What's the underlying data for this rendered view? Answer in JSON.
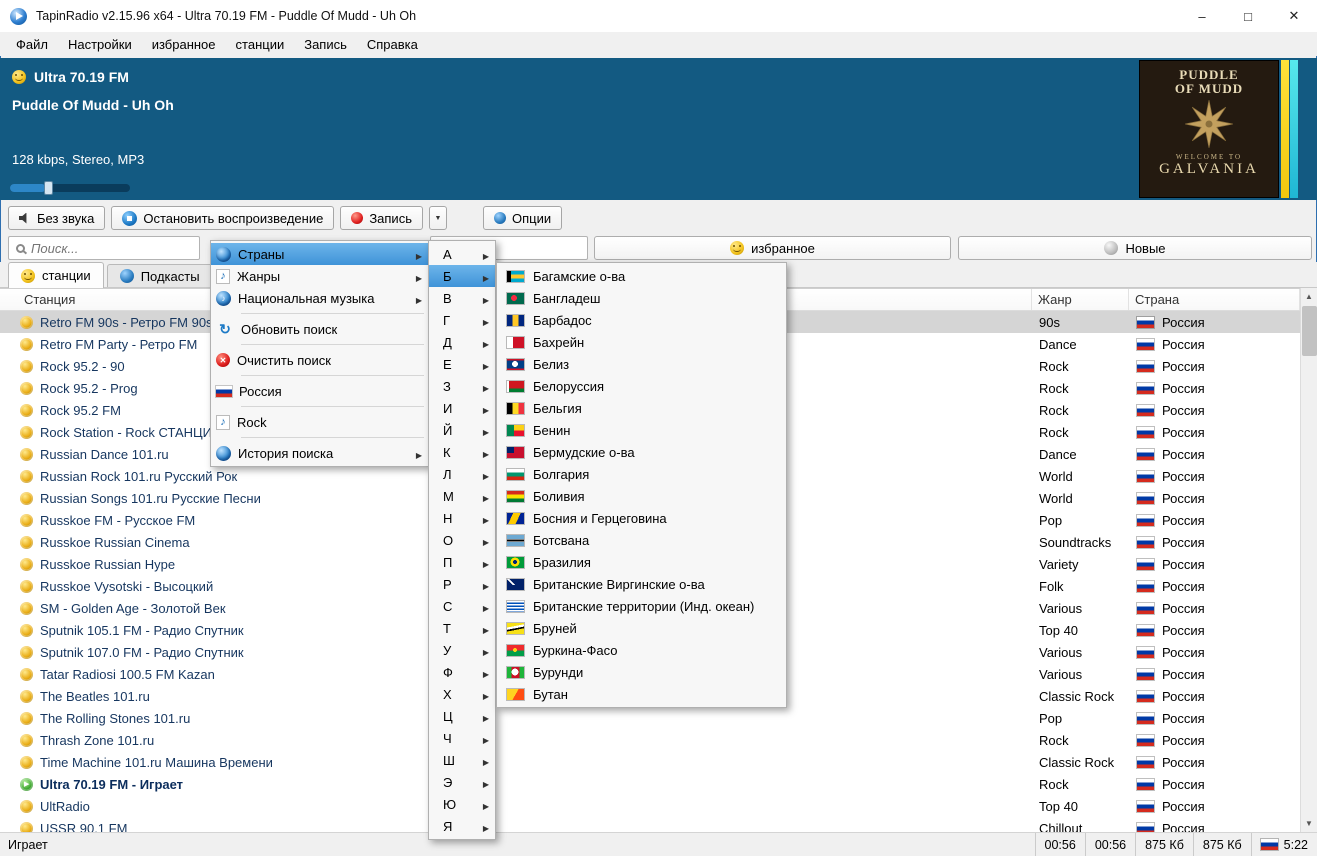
{
  "window": {
    "title": "TapinRadio v2.15.96 x64  -  Ultra 70.19 FM - Puddle Of Mudd - Uh Oh",
    "controls": {
      "minimize": "–",
      "maximize": "□",
      "close": "✕"
    }
  },
  "menubar": [
    {
      "label": "Файл"
    },
    {
      "label": "Настройки"
    },
    {
      "label": "избранное"
    },
    {
      "label": "станции"
    },
    {
      "label": "Запись"
    },
    {
      "label": "Справка"
    }
  ],
  "player": {
    "station": "Ultra 70.19 FM",
    "track": "Puddle Of Mudd - Uh Oh",
    "stream_info": "128 kbps, Stereo, MP3",
    "volume_percent": 30,
    "album": {
      "artist_line1": "PUDDLE",
      "artist_line2": "OF MUDD",
      "welcome": "WELCOME TO",
      "title": "GALVANIA"
    },
    "accent_colors": {
      "panel": "#135a82",
      "meter_yellow": "#f2c70e",
      "meter_cyan": "#1fb6d4"
    }
  },
  "toolbar": {
    "mute_label": "Без звука",
    "stop_label": "Остановить воспроизведение",
    "record_label": "Запись",
    "record_dropdown": "▼",
    "options_label": "Опции"
  },
  "filters": {
    "search_placeholder": "Поиск...",
    "favorites_label": "избранное",
    "new_label": "Новые"
  },
  "tabs": [
    {
      "label": "станции",
      "cls": "active",
      "icon": "ic-smiley"
    },
    {
      "label": "Подкасты",
      "cls": "",
      "icon": "ic-podcast"
    }
  ],
  "table": {
    "header": {
      "station": "Станция",
      "genre": "Жанр",
      "country": "Страна"
    },
    "rows": [
      {
        "name": "Retro FM 90s - Ретро FM 90s",
        "genre": "90s",
        "country": "Россия",
        "cls": "selected"
      },
      {
        "name": "Retro FM Party - Ретро FM",
        "genre": "Dance",
        "country": "Россия",
        "cls": ""
      },
      {
        "name": "Rock 95.2 - 90",
        "genre": "Rock",
        "country": "Россия",
        "cls": ""
      },
      {
        "name": "Rock 95.2 - Prog",
        "genre": "Rock",
        "country": "Россия",
        "cls": ""
      },
      {
        "name": "Rock 95.2 FM",
        "genre": "Rock",
        "country": "Россия",
        "cls": ""
      },
      {
        "name": "Rock Station - Rock СТАНЦИЯ",
        "genre": "Rock",
        "country": "Россия",
        "cls": ""
      },
      {
        "name": "Russian Dance 101.ru",
        "genre": "Dance",
        "country": "Россия",
        "cls": ""
      },
      {
        "name": "Russian Rock 101.ru Русский Рок",
        "genre": "World",
        "country": "Россия",
        "cls": ""
      },
      {
        "name": "Russian Songs 101.ru Русские Песни",
        "genre": "World",
        "country": "Россия",
        "cls": ""
      },
      {
        "name": "Russkoe FM - Русское FM",
        "genre": "Pop",
        "country": "Россия",
        "cls": ""
      },
      {
        "name": "Russkoe Russian Cinema",
        "genre": "Soundtracks",
        "country": "Россия",
        "cls": ""
      },
      {
        "name": "Russkoe Russian Hype",
        "genre": "Variety",
        "country": "Россия",
        "cls": ""
      },
      {
        "name": "Russkoe Vysotski - Высоцкий",
        "genre": "Folk",
        "country": "Россия",
        "cls": ""
      },
      {
        "name": "SM - Golden Age - Золотой Век",
        "genre": "Various",
        "country": "Россия",
        "cls": ""
      },
      {
        "name": "Sputnik 105.1 FM - Радио Спутник",
        "genre": "Top 40",
        "country": "Россия",
        "cls": ""
      },
      {
        "name": "Sputnik 107.0 FM - Радио Спутник",
        "genre": "Various",
        "country": "Россия",
        "cls": ""
      },
      {
        "name": "Tatar Radiosi 100.5 FM Kazan",
        "genre": "Various",
        "country": "Россия",
        "cls": ""
      },
      {
        "name": "The Beatles 101.ru",
        "genre": "Classic Rock",
        "country": "Россия",
        "cls": ""
      },
      {
        "name": "The Rolling Stones 101.ru",
        "genre": "Pop",
        "country": "Россия",
        "cls": ""
      },
      {
        "name": "Thrash Zone 101.ru",
        "genre": "Rock",
        "country": "Россия",
        "cls": ""
      },
      {
        "name": "Time Machine 101.ru Машина Времени",
        "genre": "Classic Rock",
        "country": "Россия",
        "cls": ""
      },
      {
        "name": "Ultra 70.19 FM - Играет",
        "genre": "Rock",
        "country": "Россия",
        "cls": "playing"
      },
      {
        "name": "UltRadio",
        "genre": "Top 40",
        "country": "Россия",
        "cls": ""
      },
      {
        "name": "USSR 90.1 FM",
        "genre": "Chillout",
        "country": "Россия",
        "cls": ""
      }
    ]
  },
  "context_menu": {
    "items": [
      {
        "label": "Страны",
        "icon": "ic-globe",
        "arrow": "has-sub",
        "cls": "hl"
      },
      {
        "label": "Жанры",
        "icon": "ic-note",
        "arrow": "has-sub",
        "cls": ""
      },
      {
        "label": "Национальная музыка",
        "icon": "ic-globe2",
        "arrow": "has-sub",
        "cls": ""
      },
      {
        "label": "",
        "icon": "",
        "arrow": "",
        "cls": "sep"
      },
      {
        "label": "Обновить поиск",
        "icon": "ic-refresh",
        "arrow": "",
        "cls": ""
      },
      {
        "label": "",
        "icon": "",
        "arrow": "",
        "cls": "sep"
      },
      {
        "label": "Очистить поиск",
        "icon": "ic-clear",
        "arrow": "",
        "cls": ""
      },
      {
        "label": "",
        "icon": "",
        "arrow": "",
        "cls": "sep"
      },
      {
        "label": "Россия",
        "icon": "ic-flag-ru",
        "arrow": "",
        "cls": ""
      },
      {
        "label": "",
        "icon": "",
        "arrow": "",
        "cls": "sep"
      },
      {
        "label": "Rock",
        "icon": "ic-note",
        "arrow": "",
        "cls": ""
      },
      {
        "label": "",
        "icon": "",
        "arrow": "",
        "cls": "sep"
      },
      {
        "label": "История поиска",
        "icon": "ic-globe",
        "arrow": "has-sub",
        "cls": ""
      }
    ]
  },
  "alphabet_menu": {
    "letters": [
      {
        "ch": "А",
        "cls": ""
      },
      {
        "ch": "Б",
        "cls": "hl"
      },
      {
        "ch": "В",
        "cls": ""
      },
      {
        "ch": "Г",
        "cls": ""
      },
      {
        "ch": "Д",
        "cls": ""
      },
      {
        "ch": "Е",
        "cls": ""
      },
      {
        "ch": "З",
        "cls": ""
      },
      {
        "ch": "И",
        "cls": ""
      },
      {
        "ch": "Й",
        "cls": ""
      },
      {
        "ch": "К",
        "cls": ""
      },
      {
        "ch": "Л",
        "cls": ""
      },
      {
        "ch": "М",
        "cls": ""
      },
      {
        "ch": "Н",
        "cls": ""
      },
      {
        "ch": "О",
        "cls": ""
      },
      {
        "ch": "П",
        "cls": ""
      },
      {
        "ch": "Р",
        "cls": ""
      },
      {
        "ch": "С",
        "cls": ""
      },
      {
        "ch": "Т",
        "cls": ""
      },
      {
        "ch": "У",
        "cls": ""
      },
      {
        "ch": "Ф",
        "cls": ""
      },
      {
        "ch": "Х",
        "cls": ""
      },
      {
        "ch": "Ц",
        "cls": ""
      },
      {
        "ch": "Ч",
        "cls": ""
      },
      {
        "ch": "Ш",
        "cls": ""
      },
      {
        "ch": "Э",
        "cls": ""
      },
      {
        "ch": "Ю",
        "cls": ""
      },
      {
        "ch": "Я",
        "cls": ""
      }
    ]
  },
  "country_menu": {
    "items": [
      {
        "name": "Багамские о-ва",
        "flag": "linear-gradient(90deg,#000 0,#000 4px,rgba(0,0,0,0) 4px),linear-gradient(180deg,#00a9ce 0,#00a9ce 33%,#ffc72c 33%,#ffc72c 67%,#00a9ce 67%)"
      },
      {
        "name": "Бангладеш",
        "flag": "radial-gradient(circle 3px at 7px 5px,#f42a41 97%,rgba(0,0,0,0) 100%),linear-gradient(#006a4e,#006a4e)"
      },
      {
        "name": "Барбадос",
        "flag": "linear-gradient(90deg,#00267f 0,#00267f 33%,#ffc726 33%,#ffc726 67%,#00267f 67%)"
      },
      {
        "name": "Бахрейн",
        "flag": "linear-gradient(90deg,#fff 0,#fff 35%,#ce1126 35%)"
      },
      {
        "name": "Белиз",
        "flag": "radial-gradient(circle 3px at 8px 5px,#fff 97%,rgba(0,0,0,0) 100%),linear-gradient(180deg,#ce1126 0,#ce1126 15%,#003f87 15%,#003f87 85%,#ce1126 85%)"
      },
      {
        "name": "Белоруссия",
        "flag": "linear-gradient(90deg,#fff 0,#fff 2px,rgba(0,0,0,0) 2px),linear-gradient(180deg,#ce1720 0,#ce1720 67%,#007c30 67%)"
      },
      {
        "name": "Бельгия",
        "flag": "linear-gradient(90deg,#000 0,#000 33%,#fdda24 33%,#fdda24 67%,#ef3340 67%)"
      },
      {
        "name": "Бенин",
        "flag": "linear-gradient(90deg,#008751 0,#008751 40%,rgba(0,0,0,0) 40%),linear-gradient(180deg,#fcd116 0,#fcd116 50%,#e8112d 50%)"
      },
      {
        "name": "Бермудские о-ва",
        "flag": "linear-gradient(#012169,#012169) 0 0/7px 6px no-repeat,#c8102e"
      },
      {
        "name": "Болгария",
        "flag": "linear-gradient(180deg,#fff 0,#fff 33%,#00966e 33%,#00966e 67%,#d62612 67%)"
      },
      {
        "name": "Боливия",
        "flag": "linear-gradient(180deg,#d52b1e 0,#d52b1e 33%,#f9e300 33%,#f9e300 67%,#007934 67%)"
      },
      {
        "name": "Босния и Герцеговина",
        "flag": "linear-gradient(115deg,#002395 0,#002395 28%,#fecb00 28%,#fecb00 62%,#002395 62%)"
      },
      {
        "name": "Ботсвана",
        "flag": "linear-gradient(180deg,#6da9d2 0,#6da9d2 35%,#fff 35%,#fff 43%,#000 43%,#000 57%,#fff 57%,#fff 65%,#6da9d2 65%)"
      },
      {
        "name": "Бразилия",
        "flag": "radial-gradient(circle 2px at 8px 5px,#002776 97%,rgba(0,0,0,0) 100%),radial-gradient(circle 4.5px at 8px 5px,#fedf00 97%,rgba(0,0,0,0) 100%),#009b3a"
      },
      {
        "name": "Британские Виргинские о-ва",
        "flag": "linear-gradient(45deg,#012169 0,#012169 42%,#fff 42%,#fff 58%,#012169 58%) 0 0/8px 6px no-repeat,#012169"
      },
      {
        "name": "Британские территории (Инд. океан)",
        "flag": "repeating-linear-gradient(180deg,#fff 0,#fff 1.5px,#0051ba 1.5px,#0051ba 3px)"
      },
      {
        "name": "Бруней",
        "flag": "linear-gradient(169deg,#f7e017 0,#f7e017 32%,#fff 32%,#fff 48%,#000 48%,#000 60%,#f7e017 60%)"
      },
      {
        "name": "Буркина-Фасо",
        "flag": "radial-gradient(circle 2px at 8px 5px,#fcd116 97%,rgba(0,0,0,0) 100%),linear-gradient(180deg,#ef2b2d 0,#ef2b2d 50%,#009e49 50%)"
      },
      {
        "name": "Бурунди",
        "flag": "radial-gradient(circle 3.5px at 8px 5px,#fff 97%,rgba(0,0,0,0) 100%),linear-gradient(90deg,#1eb53a 0,#1eb53a 26%,#ce1126 26%,#ce1126 74%,#1eb53a 74%)"
      },
      {
        "name": "Бутан",
        "flag": "linear-gradient(120deg,#ffd520 0,#ffd520 50%,#ff4e12 50%)"
      }
    ]
  },
  "statusbar": {
    "state": "Играет",
    "cells": [
      "00:56",
      "00:56",
      "875 Кб",
      "875 Кб"
    ],
    "total_time": "5:22"
  }
}
